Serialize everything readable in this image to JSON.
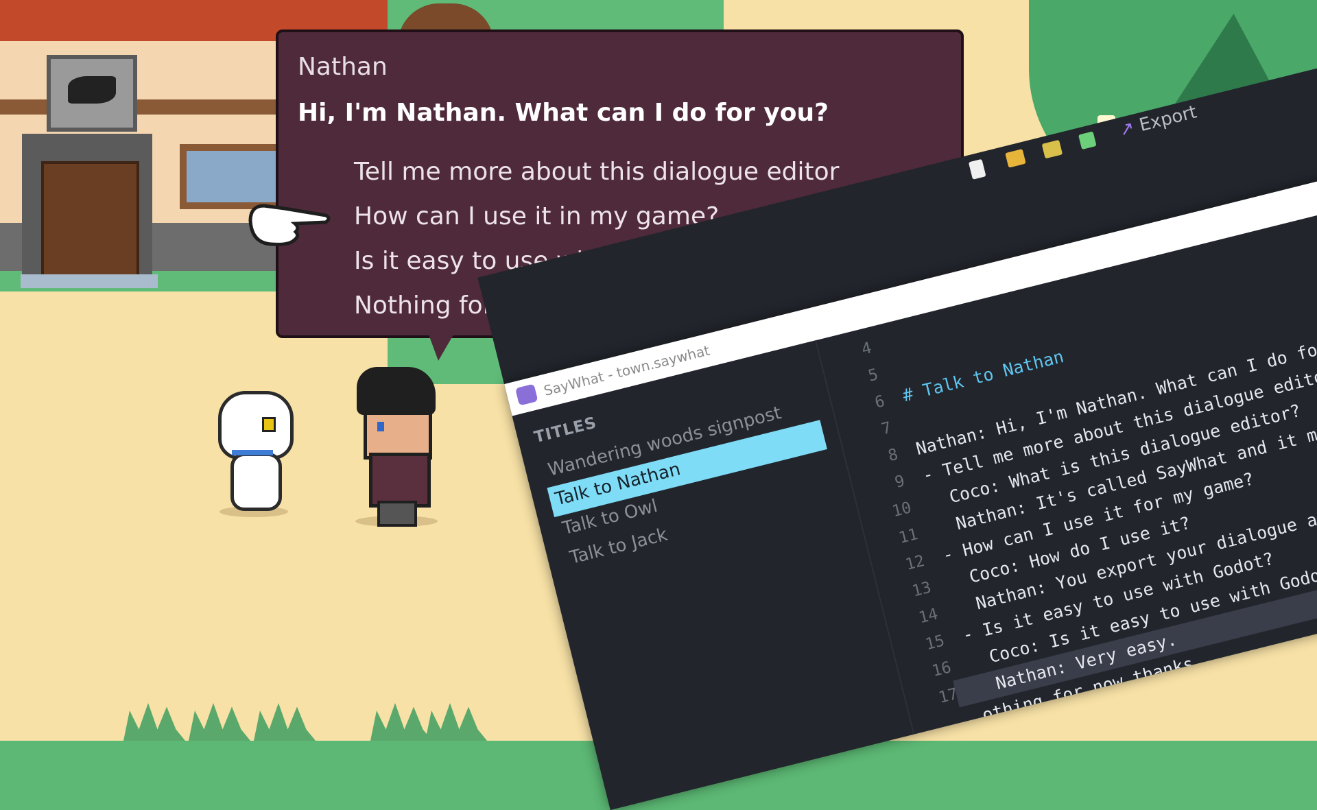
{
  "dialogue": {
    "speaker": "Nathan",
    "line": "Hi, I'm Nathan. What can I do for you?",
    "responses": [
      "Tell me more about this dialogue editor",
      "How can I use it in my game?",
      "Is it easy to use with Godot?",
      "Nothing for now thanks"
    ],
    "selected_response_index": 1
  },
  "editor": {
    "window_title": "SayWhat - town.saywhat",
    "export_label": "Export",
    "toolbar_icons": [
      "new-file-icon",
      "open-folder-icon",
      "open-recent-icon",
      "save-icon",
      "export-icon"
    ],
    "sidebar": {
      "heading": "TITLES",
      "items": [
        "Wandering woods signpost",
        "Talk to Nathan",
        "Talk to Owl",
        "Talk to Jack"
      ],
      "active_index": 1
    },
    "line_numbers": [
      "4",
      "5",
      "6",
      "7",
      "8",
      "9",
      "10",
      "11",
      "12",
      "13",
      "14",
      "15",
      "16",
      "17"
    ],
    "code_lines": [
      "",
      "",
      "# Talk to Nathan",
      "",
      "Nathan: Hi, I'm Nathan. What can I do for y",
      "- Tell me more about this dialogue editor",
      "  Coco: What is this dialogue editor?",
      "  Nathan: It's called SayWhat and it ma",
      "- How can I use it for my game?",
      "  Coco: How do I use it?",
      "  Nathan: You export your dialogue an",
      "- Is it easy to use with Godot?",
      "  Coco: Is it easy to use with Godo",
      "  Nathan: Very easy."
    ],
    "partial_last_line": "othing for now thanks",
    "current_line_index": 13
  },
  "colors": {
    "dialog_bg": "#4e2a3b",
    "editor_bg": "#22252c",
    "active_title": "#7fdcf7",
    "heading_code": "#5fc6f0",
    "export_accent": "#a07af0"
  }
}
